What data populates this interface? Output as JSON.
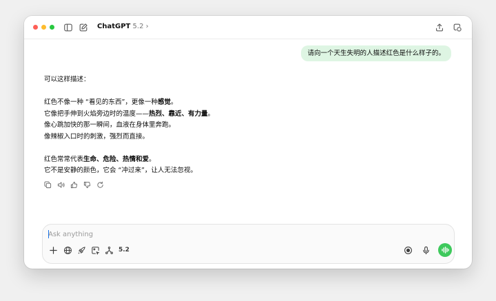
{
  "window": {
    "model_name": "ChatGPT",
    "model_version": "5.2",
    "model_chevron": "›"
  },
  "conversation": {
    "user_message": "请向一个天生失明的人描述红色是什么样子的。",
    "assistant_lines": [
      "可以这样描述：",
      "",
      "红色不像一种 “看见的东西”，更像一种感觉。",
      "它像把手伸到火焰旁边时的温度——热烈、靠近、有力量。",
      "像心跳加快的那一瞬间，血液在身体里奔跑。",
      "像辣椒入口时的刺激，强烈而直接。",
      "",
      "红色常常代表生命、危险、热情和爱。",
      "它不是安静的颜色，它会 “冲过来”，让人无法忽视。"
    ]
  },
  "composer": {
    "placeholder": "Ask anything",
    "version_chip": "5.2"
  },
  "colors": {
    "user_bubble": "#def5e3",
    "voice_button": "#3ec95c"
  },
  "icons": {
    "titlebar": [
      "sidebar-icon",
      "new-chat-icon",
      "share-icon",
      "temporary-chat-icon"
    ],
    "message_actions": [
      "copy-icon",
      "read-aloud-icon",
      "thumbs-up-icon",
      "thumbs-down-icon",
      "regenerate-icon"
    ],
    "composer_tools": [
      "plus-icon",
      "globe-icon",
      "rocket-icon",
      "image-icon",
      "connectors-icon",
      "record-icon",
      "microphone-icon",
      "voice-mode-icon"
    ]
  }
}
